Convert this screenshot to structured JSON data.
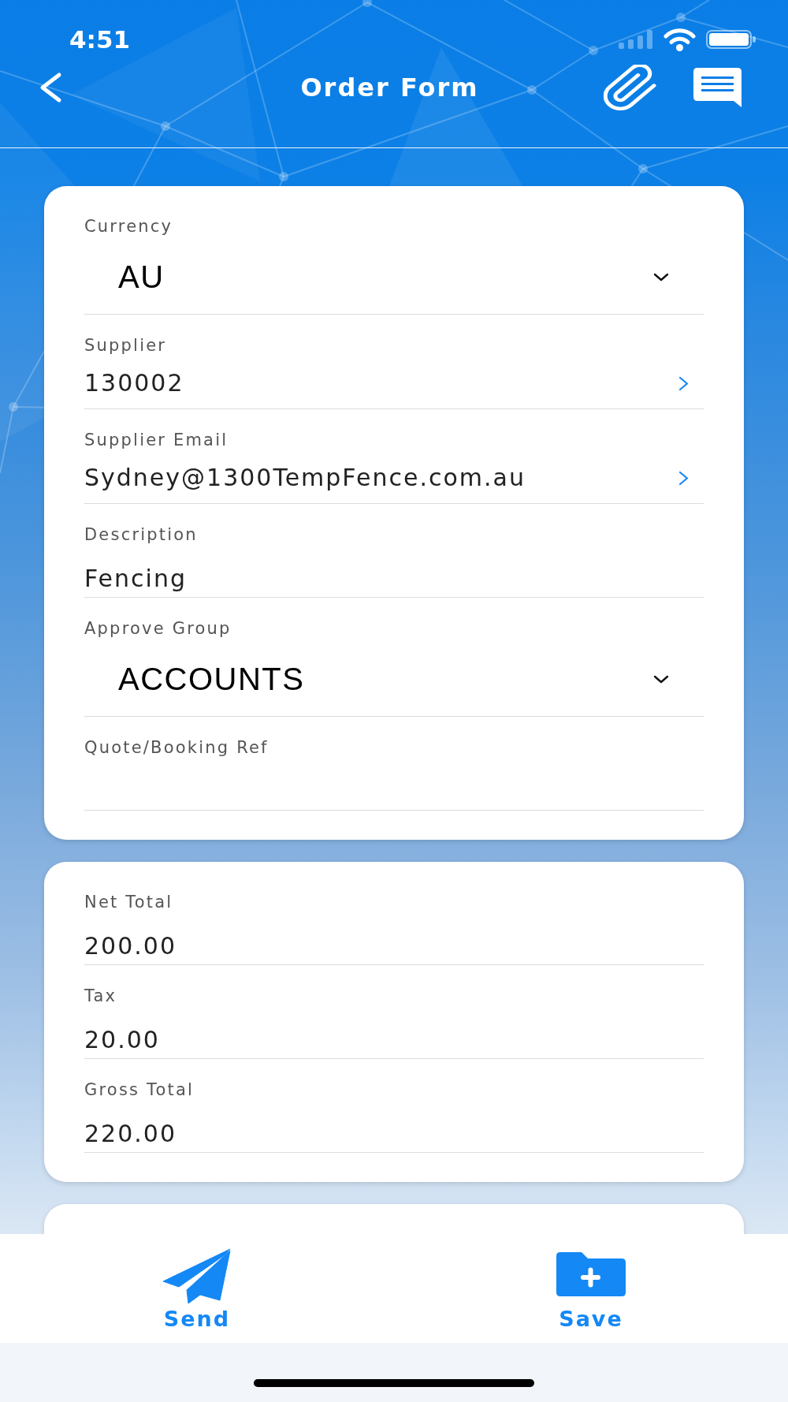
{
  "status_bar": {
    "time": "4:51"
  },
  "nav_bar": {
    "title": "Order Form"
  },
  "form_sections": [
    {
      "fields": [
        {
          "kind": "dropdown",
          "label": "Currency",
          "value": "AU"
        },
        {
          "kind": "link",
          "label": "Supplier",
          "value": "130002"
        },
        {
          "kind": "link",
          "label": "Supplier Email",
          "value": "Sydney@1300TempFence.com.au"
        },
        {
          "kind": "text",
          "label": "Description",
          "value": "Fencing"
        },
        {
          "kind": "dropdown",
          "label": "Approve Group",
          "value": "ACCOUNTS"
        },
        {
          "kind": "text",
          "label": "Quote/Booking Ref"
        }
      ]
    },
    {
      "fields": [
        {
          "kind": "text",
          "label": "Net Total",
          "value": "200.00"
        },
        {
          "kind": "text",
          "label": "Tax",
          "value": "20.00"
        },
        {
          "kind": "text",
          "label": "Gross Total",
          "value": "220.00"
        }
      ]
    }
  ],
  "toolbar": {
    "buttons": [
      {
        "kind": "send",
        "label": "Send"
      },
      {
        "kind": "save",
        "label": "Save"
      }
    ]
  }
}
